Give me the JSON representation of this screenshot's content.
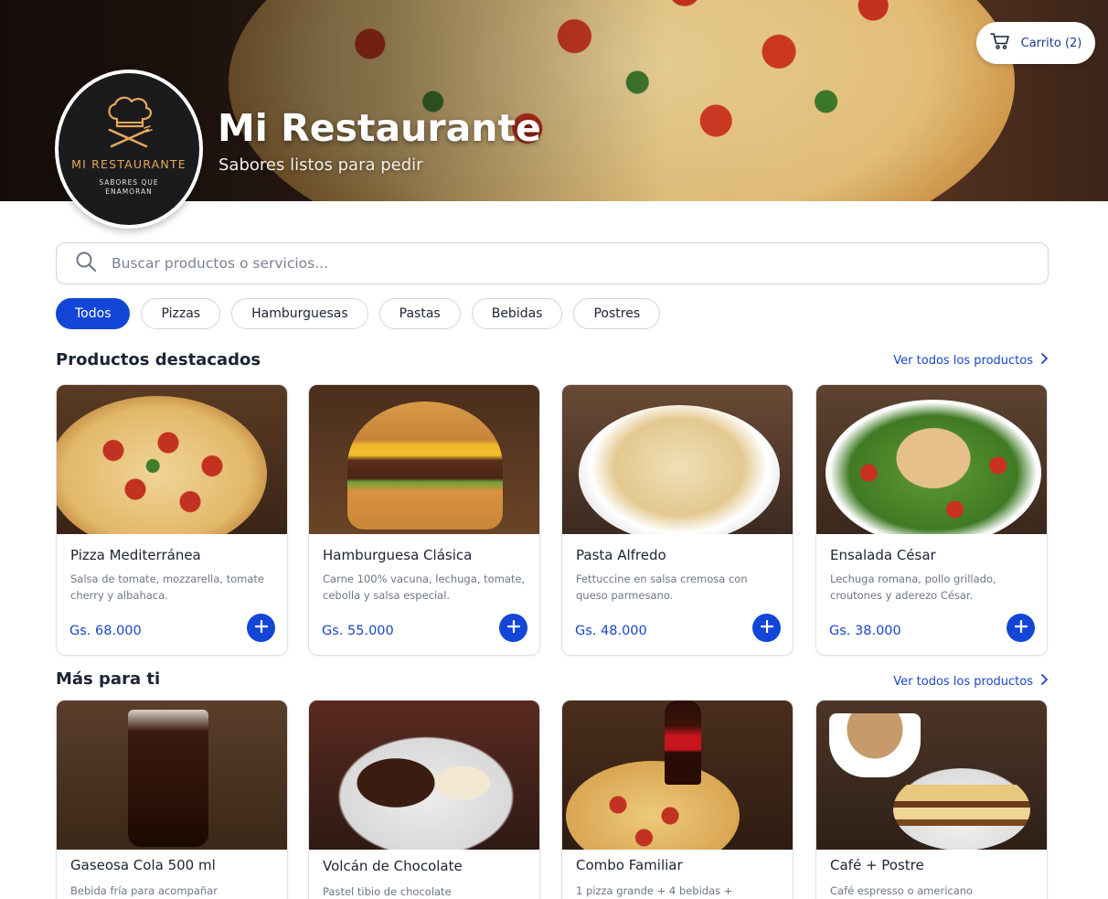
{
  "header": {
    "title": "Mi Restaurante",
    "subtitle": "Sabores listos para pedir",
    "logo": {
      "name": "MI RESTAURANTE",
      "tagline": "SABORES QUE ENAMORAN"
    },
    "cart": {
      "label": "Carrito (2)",
      "icon": "cart-icon"
    }
  },
  "search": {
    "placeholder": "Buscar productos o servicios...",
    "value": ""
  },
  "categories": [
    "Todos",
    "Pizzas",
    "Hamburguesas",
    "Pastas",
    "Bebidas",
    "Postres"
  ],
  "active_category": "Todos",
  "featured": {
    "title": "Productos destacados",
    "see_all": "Ver todos los productos",
    "products": [
      {
        "name": "Pizza Mediterránea",
        "desc": "Salsa de tomate, mozzarella, tomate cherry y albahaca.",
        "price": "Gs. 68.000"
      },
      {
        "name": "Hamburguesa Clásica",
        "desc": "Carne 100% vacuna, lechuga, tomate, cebolla y salsa especial.",
        "price": "Gs. 55.000"
      },
      {
        "name": "Pasta Alfredo",
        "desc": "Fettuccine en salsa cremosa con queso parmesano.",
        "price": "Gs. 48.000"
      },
      {
        "name": "Ensalada César",
        "desc": "Lechuga romana, pollo grillado, croutones y aderezo César.",
        "price": "Gs. 38.000"
      }
    ]
  },
  "more": {
    "title": "Más para ti",
    "see_all": "Ver todos los productos",
    "products": [
      {
        "name": "Gaseosa Cola 500 ml",
        "desc": "Bebida fría para acompañar"
      },
      {
        "name": "Volcán de Chocolate",
        "desc": "Pastel tibio de chocolate"
      },
      {
        "name": "Combo Familiar",
        "desc": "1 pizza grande + 4 bebidas +"
      },
      {
        "name": "Café + Postre",
        "desc": "Café espresso o americano"
      }
    ]
  },
  "colors": {
    "accent": "#1346d6",
    "link": "#1a45c9",
    "border": "#dde1e8"
  }
}
